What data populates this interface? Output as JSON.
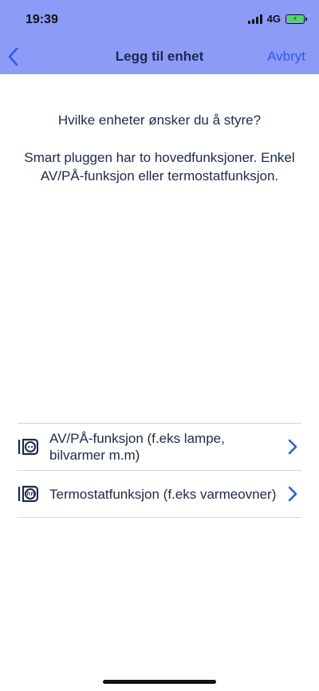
{
  "status_bar": {
    "time": "19:39",
    "network": "4G"
  },
  "nav": {
    "title": "Legg til enhet",
    "cancel_label": "Avbryt",
    "back_icon": "chevron-left-icon"
  },
  "intro": {
    "question": "Hvilke enheter ønsker du å styre?",
    "description": "Smart pluggen har to hovedfunksjoner. Enkel AV/PÅ-funksjon eller termostatfunksjon."
  },
  "options": [
    {
      "label": "AV/PÅ-funksjon (f.eks lampe, bilvarmer m.m)",
      "icon": "socket-icon"
    },
    {
      "label": "Termostatfunksjon (f.eks varmeovner)",
      "icon": "heater-socket-icon"
    }
  ],
  "colors": {
    "header_bg": "#8c9bf6",
    "accent": "#2d5cf2",
    "text": "#1c2a4a",
    "divider": "#d6d6d6"
  }
}
